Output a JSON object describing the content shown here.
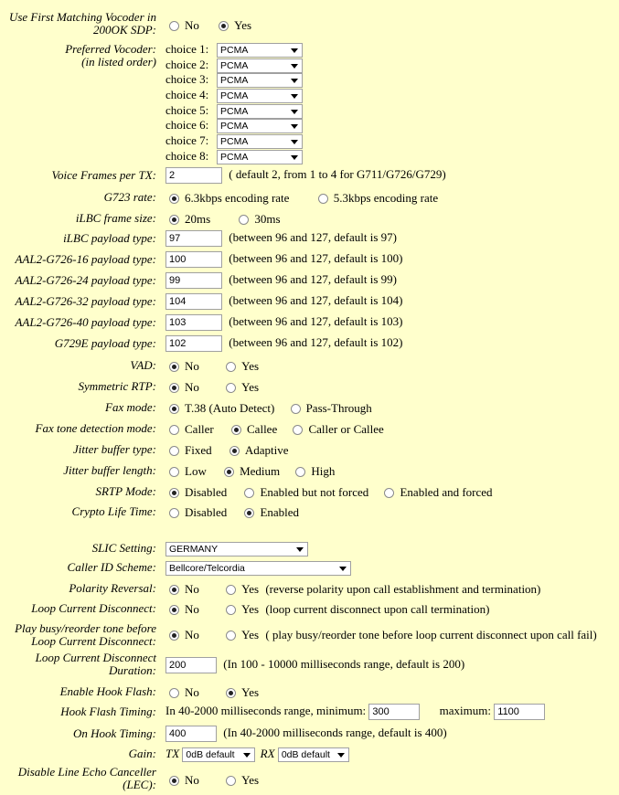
{
  "first_match": {
    "label_line1": "Use First Matching Vocoder in",
    "label_line2": "200OK SDP:",
    "opt_no": "No",
    "opt_yes": "Yes"
  },
  "pref_vocoder": {
    "label_line1": "Preferred Vocoder:",
    "label_line2": "(in listed order)",
    "choices": [
      {
        "label": "choice 1:",
        "value": "PCMA"
      },
      {
        "label": "choice 2:",
        "value": "PCMA"
      },
      {
        "label": "choice 3:",
        "value": "PCMA"
      },
      {
        "label": "choice 4:",
        "value": "PCMA"
      },
      {
        "label": "choice 5:",
        "value": "PCMA"
      },
      {
        "label": "choice 6:",
        "value": "PCMA"
      },
      {
        "label": "choice 7:",
        "value": "PCMA"
      },
      {
        "label": "choice 8:",
        "value": "PCMA"
      }
    ]
  },
  "voice_frames": {
    "label": "Voice Frames per TX:",
    "value": "2",
    "note": "( default 2, from 1 to 4 for G711/G726/G729)"
  },
  "g723": {
    "label": "G723 rate:",
    "opt1": "6.3kbps encoding rate",
    "opt2": "5.3kbps encoding rate"
  },
  "ilbc_frame": {
    "label": "iLBC frame size:",
    "opt1": "20ms",
    "opt2": "30ms"
  },
  "ilbc_payload": {
    "label": "iLBC payload type:",
    "value": "97",
    "note": "(between 96 and 127, default is 97)"
  },
  "aal2_16": {
    "label": "AAL2-G726-16 payload type:",
    "value": "100",
    "note": "(between 96 and 127, default is 100)"
  },
  "aal2_24": {
    "label": "AAL2-G726-24 payload type:",
    "value": "99",
    "note": "(between 96 and 127, default is 99)"
  },
  "aal2_32": {
    "label": "AAL2-G726-32 payload type:",
    "value": "104",
    "note": "(between 96 and 127, default is 104)"
  },
  "aal2_40": {
    "label": "AAL2-G726-40 payload type:",
    "value": "103",
    "note": "(between 96 and 127, default is 103)"
  },
  "g729e": {
    "label": "G729E payload type:",
    "value": "102",
    "note": "(between 96 and 127, default is 102)"
  },
  "vad": {
    "label": "VAD:",
    "opt1": "No",
    "opt2": "Yes"
  },
  "sym_rtp": {
    "label": "Symmetric RTP:",
    "opt1": "No",
    "opt2": "Yes"
  },
  "fax_mode": {
    "label": "Fax mode:",
    "opt1": "T.38 (Auto Detect)",
    "opt2": "Pass-Through"
  },
  "fax_tone": {
    "label": "Fax tone detection mode:",
    "opt1": "Caller",
    "opt2": "Callee",
    "opt3": "Caller or Callee"
  },
  "jitter_type": {
    "label": "Jitter buffer type:",
    "opt1": "Fixed",
    "opt2": "Adaptive"
  },
  "jitter_len": {
    "label": "Jitter buffer length:",
    "opt1": "Low",
    "opt2": "Medium",
    "opt3": "High"
  },
  "srtp": {
    "label": "SRTP Mode:",
    "opt1": "Disabled",
    "opt2": "Enabled but not forced",
    "opt3": "Enabled and forced"
  },
  "crypto": {
    "label": "Crypto Life Time:",
    "opt1": "Disabled",
    "opt2": "Enabled"
  },
  "slic": {
    "label": "SLIC Setting:",
    "value": "GERMANY"
  },
  "caller_id": {
    "label": "Caller ID Scheme:",
    "value": "Bellcore/Telcordia"
  },
  "polarity": {
    "label": "Polarity Reversal:",
    "opt1": "No",
    "opt2": "Yes",
    "note": "(reverse polarity upon call establishment and termination)"
  },
  "loop_disc": {
    "label": "Loop Current Disconnect:",
    "opt1": "No",
    "opt2": "Yes",
    "note": "(loop current disconnect upon call termination)"
  },
  "busy_tone": {
    "label_line1": "Play busy/reorder tone before",
    "label_line2": "Loop Current Disconnect:",
    "opt1": "No",
    "opt2": "Yes",
    "note": "( play busy/reorder tone before loop current disconnect upon call fail)"
  },
  "loop_dur": {
    "label_line1": "Loop Current Disconnect",
    "label_line2": "Duration:",
    "value": "200",
    "note": "(In 100 - 10000 milliseconds range, default is 200)"
  },
  "hook_flash": {
    "label": "Enable Hook Flash:",
    "opt1": "No",
    "opt2": "Yes"
  },
  "hook_timing": {
    "label": "Hook Flash Timing:",
    "prefix": "In 40-2000 milliseconds range, minimum:",
    "min": "300",
    "max_label": "maximum:",
    "max": "1100"
  },
  "on_hook": {
    "label": "On Hook Timing:",
    "value": "400",
    "note": "(In 40-2000 milliseconds range, default is 400)"
  },
  "gain": {
    "label": "Gain:",
    "tx_label": "TX",
    "tx_value": "0dB default",
    "rx_label": "RX",
    "rx_value": "0dB default"
  },
  "lec": {
    "label_line1": "Disable Line Echo Canceller",
    "label_line2": "(LEC):",
    "opt1": "No",
    "opt2": "Yes"
  }
}
